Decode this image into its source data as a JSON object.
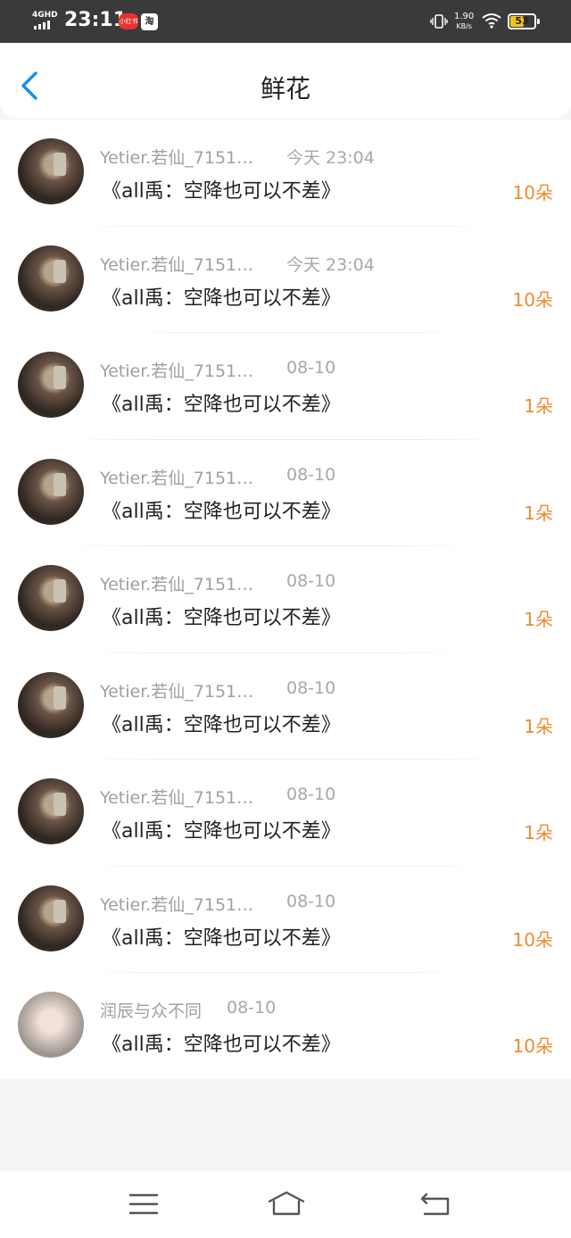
{
  "status_bar": {
    "network": "4GHD",
    "time": "23:11",
    "app_badge_1": "小红书",
    "app_badge_2": "淘",
    "speed_value": "1.90",
    "speed_unit": "KB/s",
    "battery": "53",
    "battery_fill_percent": 53
  },
  "header": {
    "title": "鲜花",
    "back_icon": "chevron-left-icon"
  },
  "rows": [
    {
      "name": "Yetier.若仙_7151…",
      "time": "今天 23:04",
      "book": "《all禹：空降也可以不差》",
      "count": "10朵"
    },
    {
      "name": "Yetier.若仙_7151…",
      "time": "今天 23:04",
      "book": "《all禹：空降也可以不差》",
      "count": "10朵"
    },
    {
      "name": "Yetier.若仙_7151…",
      "time": "08-10",
      "book": "《all禹：空降也可以不差》",
      "count": "1朵"
    },
    {
      "name": "Yetier.若仙_7151…",
      "time": "08-10",
      "book": "《all禹：空降也可以不差》",
      "count": "1朵"
    },
    {
      "name": "Yetier.若仙_7151…",
      "time": "08-10",
      "book": "《all禹：空降也可以不差》",
      "count": "1朵"
    },
    {
      "name": "Yetier.若仙_7151…",
      "time": "08-10",
      "book": "《all禹：空降也可以不差》",
      "count": "1朵"
    },
    {
      "name": "Yetier.若仙_7151…",
      "time": "08-10",
      "book": "《all禹：空降也可以不差》",
      "count": "1朵"
    },
    {
      "name": "Yetier.若仙_7151…",
      "time": "08-10",
      "book": "《all禹：空降也可以不差》",
      "count": "10朵"
    },
    {
      "name": "润辰与众不同",
      "time": "08-10",
      "book": "《all禹：空降也可以不差》",
      "count": "10朵"
    }
  ],
  "nav": {
    "menu_icon": "menu-icon",
    "home_icon": "home-icon",
    "back_icon": "return-icon"
  },
  "colors": {
    "accent": "#1a8fe3",
    "count": "#f08a2c",
    "status_bar": "#3a3a3a"
  }
}
